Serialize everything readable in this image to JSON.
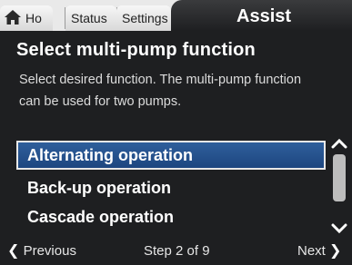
{
  "tabs": {
    "home": "Ho",
    "status": "Status",
    "settings": "Settings",
    "active": "Assist"
  },
  "main": {
    "title": "Select multi-pump function",
    "description": "Select desired function. The multi-pump function can be used for two pumps."
  },
  "list": {
    "items": [
      {
        "label": "Alternating operation",
        "selected": true
      },
      {
        "label": "Back-up operation",
        "selected": false
      },
      {
        "label": "Cascade operation",
        "selected": false
      }
    ]
  },
  "footer": {
    "previous_label": "Previous",
    "step_text": "Step 2 of 9",
    "next_label": "Next"
  },
  "colors": {
    "background": "#1e1f21",
    "selection": "#2f5f9c",
    "tab_inactive": "#e9e9e9"
  }
}
